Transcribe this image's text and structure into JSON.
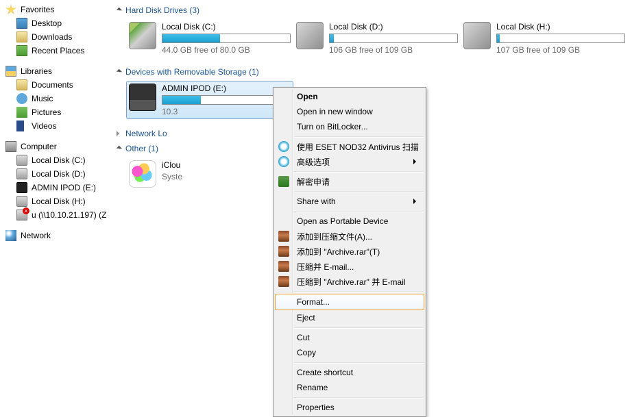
{
  "sidebar": {
    "favorites": {
      "label": "Favorites",
      "items": [
        "Desktop",
        "Downloads",
        "Recent Places"
      ]
    },
    "libraries": {
      "label": "Libraries",
      "items": [
        "Documents",
        "Music",
        "Pictures",
        "Videos"
      ]
    },
    "computer": {
      "label": "Computer",
      "items": [
        "Local Disk (C:)",
        "Local Disk (D:)",
        "ADMIN IPOD (E:)",
        "Local Disk (H:)",
        "u (\\\\10.10.21.197) (Z"
      ]
    },
    "network": {
      "label": "Network"
    }
  },
  "sections": {
    "hdd": {
      "label": "Hard Disk Drives (3)",
      "drives": [
        {
          "name": "Local Disk (C:)",
          "free": "44.0 GB free of 80.0 GB",
          "fill_pct": 45
        },
        {
          "name": "Local Disk (D:)",
          "free": "106 GB free of 109 GB",
          "fill_pct": 3
        },
        {
          "name": "Local Disk (H:)",
          "free": "107 GB free of 109 GB",
          "fill_pct": 2
        }
      ]
    },
    "removable": {
      "label": "Devices with Removable Storage (1)",
      "drives": [
        {
          "name": "ADMIN IPOD (E:)",
          "free": "10.3",
          "fill_pct": 30
        }
      ]
    },
    "netloc": {
      "label": "Network Lo"
    },
    "other": {
      "label": "Other (1)",
      "items": [
        {
          "name": "iClou",
          "sub": "Syste"
        }
      ]
    }
  },
  "context_menu": {
    "open": "Open",
    "open_new": "Open in new window",
    "bitlocker": "Turn on BitLocker...",
    "eset": "使用 ESET NOD32 Antivirus 扫描",
    "advanced": "高级选项",
    "decrypt": "解密申请",
    "share": "Share with",
    "portable": "Open as Portable Device",
    "rar1": "添加到压缩文件(A)...",
    "rar2": "添加到 \"Archive.rar\"(T)",
    "rar3": "压缩并 E-mail...",
    "rar4": "压缩到 \"Archive.rar\" 并 E-mail",
    "format": "Format...",
    "eject": "Eject",
    "cut": "Cut",
    "copy": "Copy",
    "shortcut": "Create shortcut",
    "rename": "Rename",
    "properties": "Properties"
  }
}
